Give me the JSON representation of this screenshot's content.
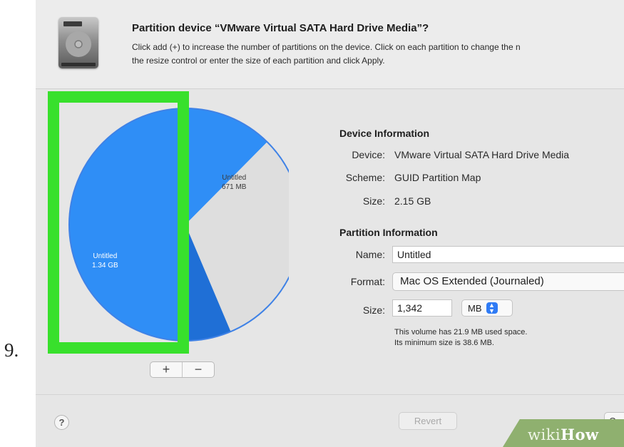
{
  "step": {
    "number": "9."
  },
  "dialog": {
    "title": "Partition device “VMware Virtual SATA Hard Drive Media”?",
    "description_line1": "Click add (+) to increase the number of partitions on the device. Click on each partition to change the n",
    "description_line2": "the resize control or enter the size of each partition and click Apply."
  },
  "chart_data": {
    "type": "pie",
    "slices": [
      {
        "label": "Untitled",
        "size_text": "1.34 GB",
        "value_mb": 1342,
        "color": "#2f8ef6"
      },
      {
        "label": "Untitled",
        "size_text": "671 MB",
        "value_mb": 671,
        "color": "#dedede"
      },
      {
        "label": "",
        "size_text": "",
        "value_mb": 137,
        "color": "#1f6fd6"
      }
    ],
    "selected_slice": 0,
    "highlight_color": "#38e02c"
  },
  "partition_controls": {
    "add_label": "+",
    "remove_label": "−"
  },
  "device_info": {
    "heading": "Device Information",
    "device_label": "Device:",
    "device_value": "VMware Virtual SATA Hard Drive Media",
    "scheme_label": "Scheme:",
    "scheme_value": "GUID Partition Map",
    "size_label": "Size:",
    "size_value": "2.15 GB"
  },
  "partition_info": {
    "heading": "Partition Information",
    "name_label": "Name:",
    "name_value": "Untitled",
    "format_label": "Format:",
    "format_value": "Mac OS Extended (Journaled)",
    "size_label": "Size:",
    "size_value": "1,342",
    "size_unit": "MB",
    "note_line1": "This volume has 21.9 MB used space.",
    "note_line2": "Its minimum size is 38.6 MB."
  },
  "footer": {
    "help_label": "?",
    "revert_label": "Revert",
    "cancel_label": "C"
  },
  "watermark": {
    "part1": "wiki",
    "part2": "How"
  },
  "colors": {
    "accent": "#2f7bf5",
    "highlight": "#38e02c",
    "dialog_bg": "#e6e6e6"
  }
}
